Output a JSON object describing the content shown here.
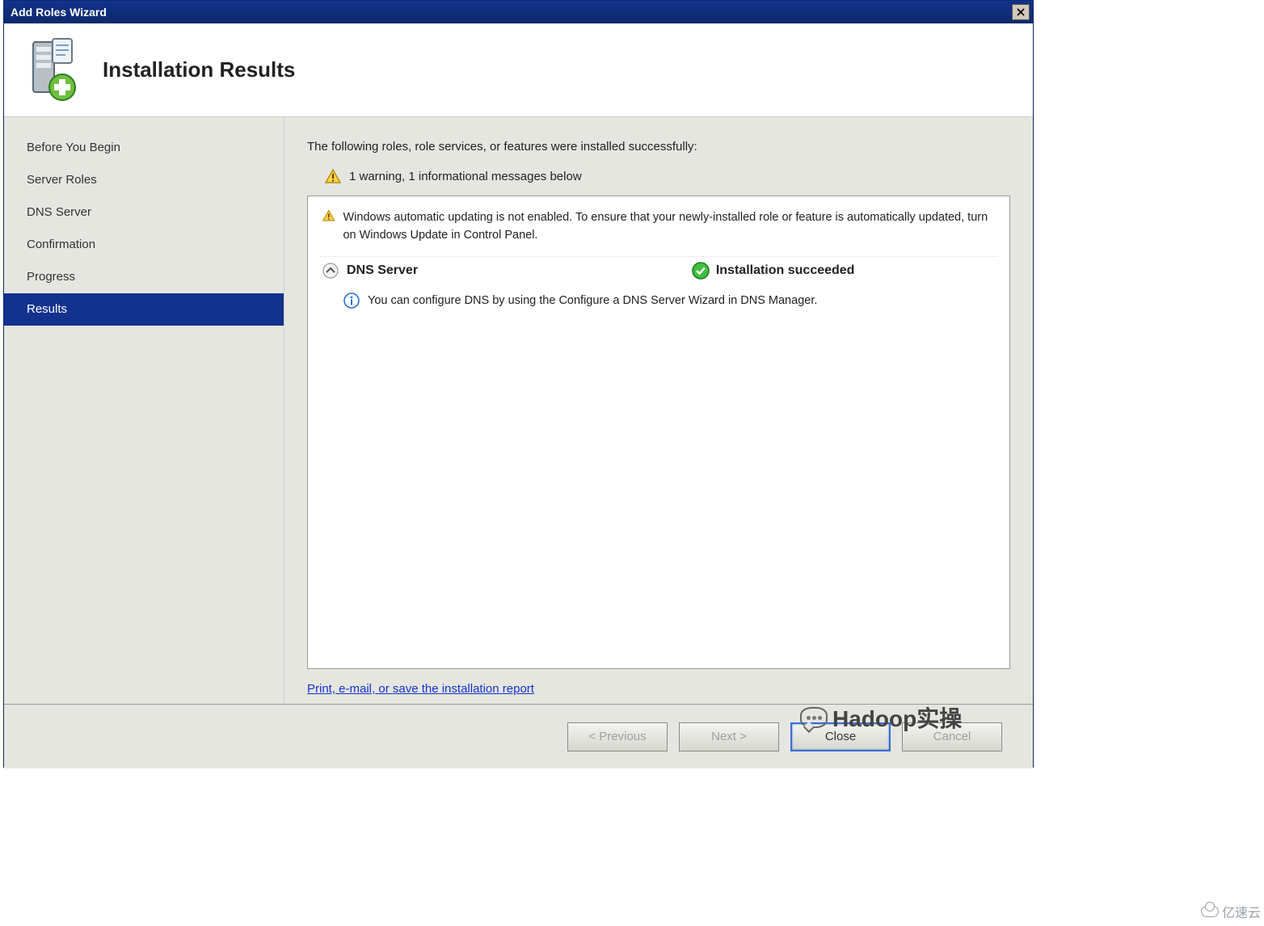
{
  "window": {
    "title": "Add Roles Wizard"
  },
  "header": {
    "title": "Installation Results"
  },
  "sidebar": {
    "items": [
      {
        "label": "Before You Begin",
        "selected": false
      },
      {
        "label": "Server Roles",
        "selected": false
      },
      {
        "label": "DNS Server",
        "selected": false
      },
      {
        "label": "Confirmation",
        "selected": false
      },
      {
        "label": "Progress",
        "selected": false
      },
      {
        "label": "Results",
        "selected": true
      }
    ]
  },
  "main": {
    "intro": "The following roles, role services, or features were installed successfully:",
    "summary": "1 warning, 1 informational messages below",
    "warning_text": "Windows automatic updating is not enabled. To ensure that your newly-installed role or feature is automatically updated, turn on Windows Update in Control Panel.",
    "role": {
      "name": "DNS Server",
      "status": "Installation succeeded"
    },
    "info_text": "You can configure DNS by using the Configure a DNS Server Wizard in DNS Manager.",
    "report_link": "Print, e-mail, or save the installation report"
  },
  "buttons": {
    "previous": "< Previous",
    "next": "Next >",
    "close": "Close",
    "cancel": "Cancel"
  },
  "overlays": {
    "watermark1": "Hadoop实操",
    "watermark2": "亿速云"
  }
}
